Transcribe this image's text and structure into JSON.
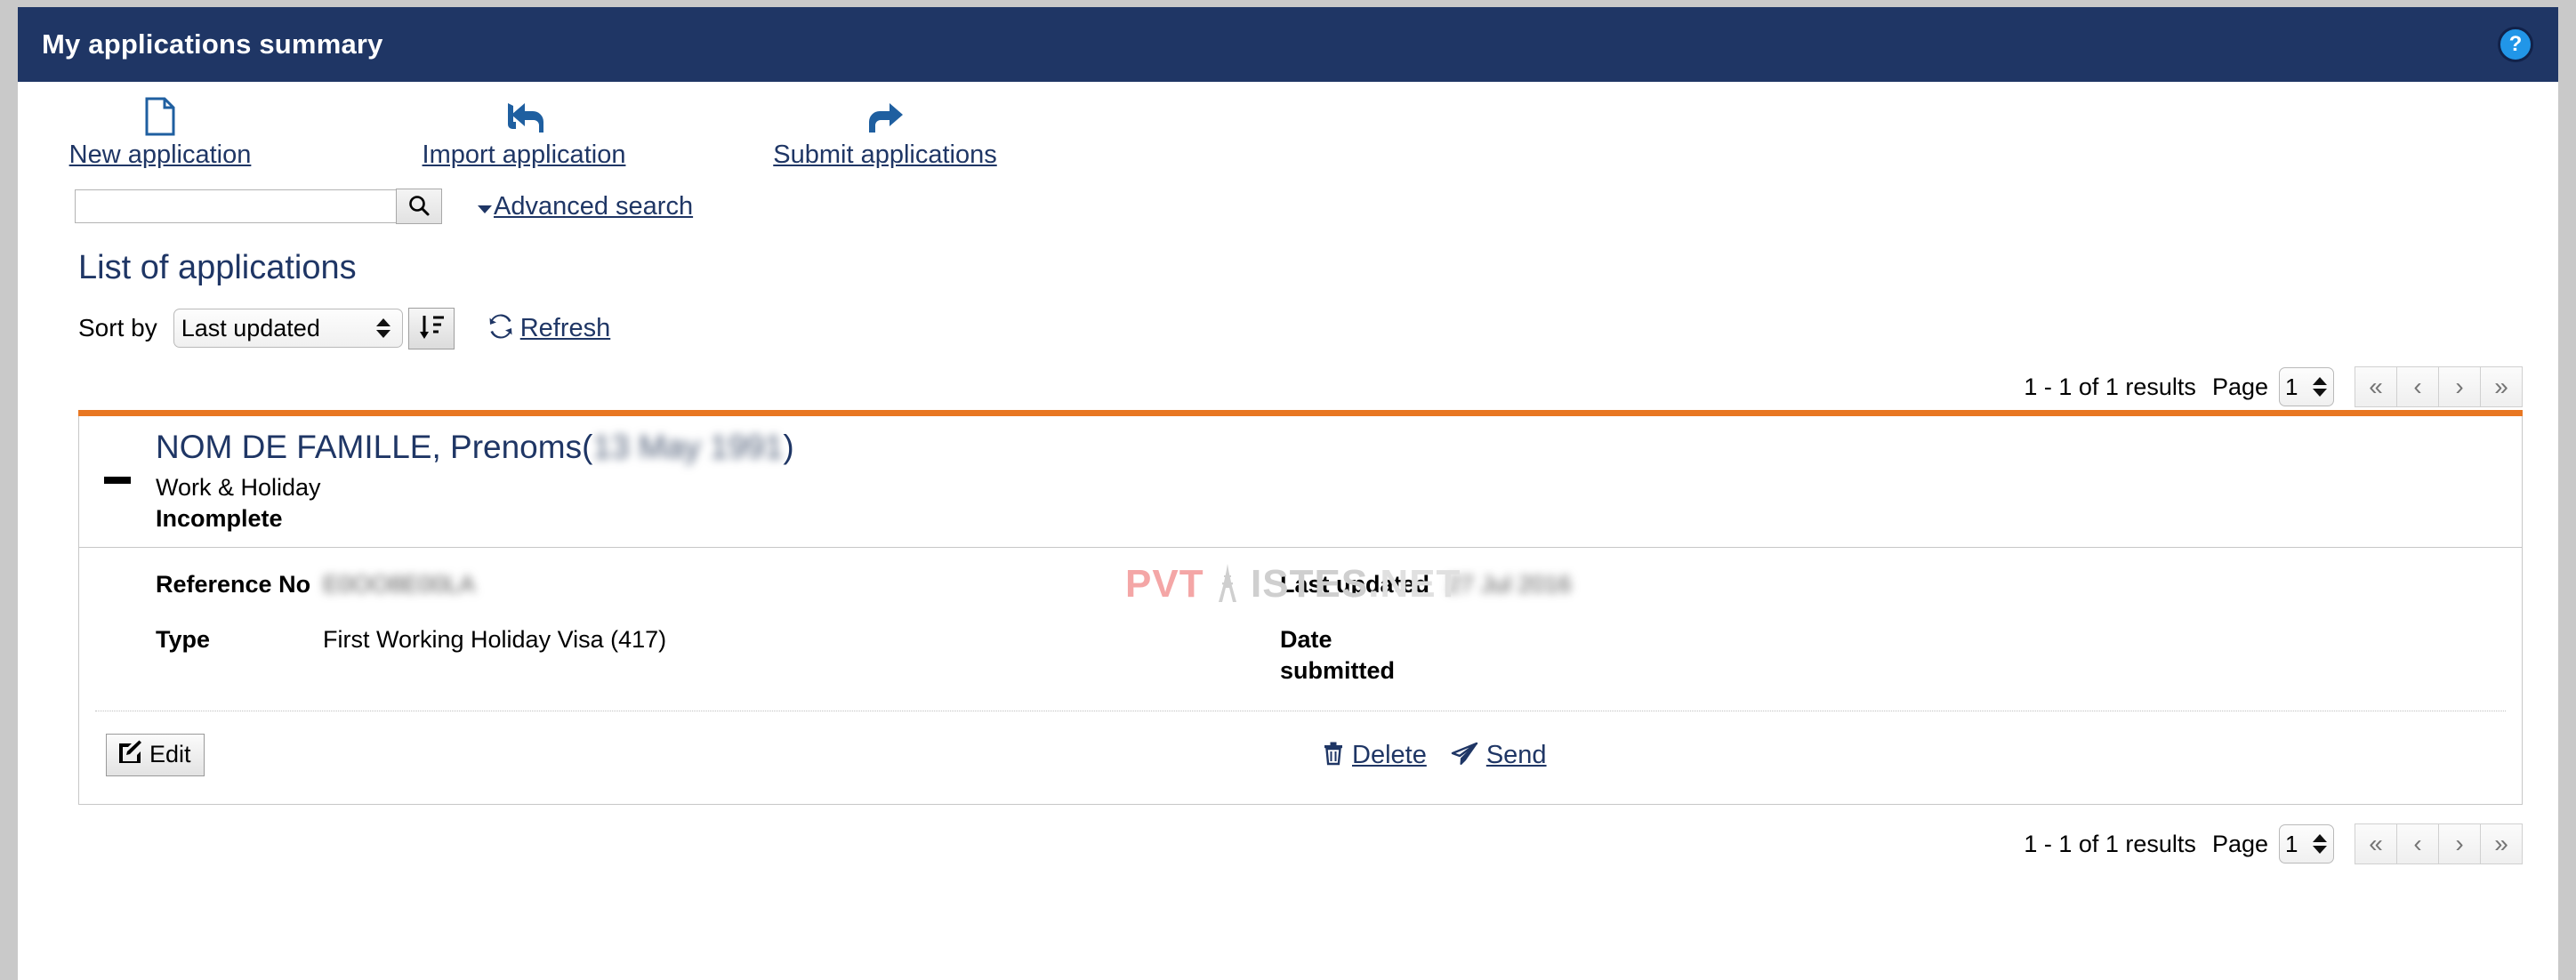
{
  "window": {
    "title": "My applications summary",
    "help_icon": "help-circle-icon",
    "help_label": "?"
  },
  "colors": {
    "header_bg": "#1f3665",
    "accent_orange": "#e87722",
    "link_blue": "#1f3665",
    "help_blue": "#2196e8"
  },
  "quick_actions": [
    {
      "id": "new-application",
      "label": "New application",
      "icon": "document-icon"
    },
    {
      "id": "import-application",
      "label": "Import application",
      "icon": "reply-arrow-icon"
    },
    {
      "id": "submit-applications",
      "label": "Submit applications",
      "icon": "forward-arrow-icon"
    }
  ],
  "search": {
    "value": "",
    "placeholder": "",
    "button_icon": "search-icon",
    "advanced_label": "Advanced search",
    "advanced_caret": "chevron-down-icon"
  },
  "list": {
    "heading": "List of applications",
    "sort_label": "Sort by",
    "sort_value": "Last updated",
    "sort_options": [
      "Last updated"
    ],
    "sort_direction_icon": "sort-descending-icon",
    "refresh_label": "Refresh",
    "refresh_icon": "refresh-icon"
  },
  "pagination": {
    "results_text": "1 - 1 of 1 results",
    "page_label": "Page",
    "page_value": "1",
    "page_options": [
      "1"
    ],
    "buttons": [
      {
        "id": "first-page",
        "glyph": "«",
        "name": "first-page-button"
      },
      {
        "id": "prev-page",
        "glyph": "‹",
        "name": "previous-page-button"
      },
      {
        "id": "next-page",
        "glyph": "›",
        "name": "next-page-button"
      },
      {
        "id": "last-page",
        "glyph": "»",
        "name": "last-page-button"
      }
    ]
  },
  "application": {
    "collapse_icon": "minus-icon",
    "name": "NOM DE FAMILLE, Prenoms",
    "dob_open_paren": "(",
    "dob_blurred": "13 May 1991",
    "dob_close_paren": ")",
    "program": "Work & Holiday",
    "status": "Incomplete",
    "details": {
      "reference_no_label": "Reference No",
      "reference_no_value": "E0OO8E00LA",
      "type_label": "Type",
      "type_value": "First Working Holiday Visa (417)",
      "last_updated_label": "Last updated",
      "last_updated_value": "27 Jul 2016",
      "date_submitted_label": "Date submitted",
      "date_submitted_value": ""
    },
    "actions": {
      "edit_label": "Edit",
      "edit_icon": "pencil-square-icon",
      "delete_label": "Delete",
      "delete_icon": "trash-icon",
      "send_label": "Send",
      "send_icon": "paper-plane-icon"
    }
  },
  "watermark": {
    "part1": "PVT",
    "part2": "ISTES",
    "part3": ".NET"
  }
}
